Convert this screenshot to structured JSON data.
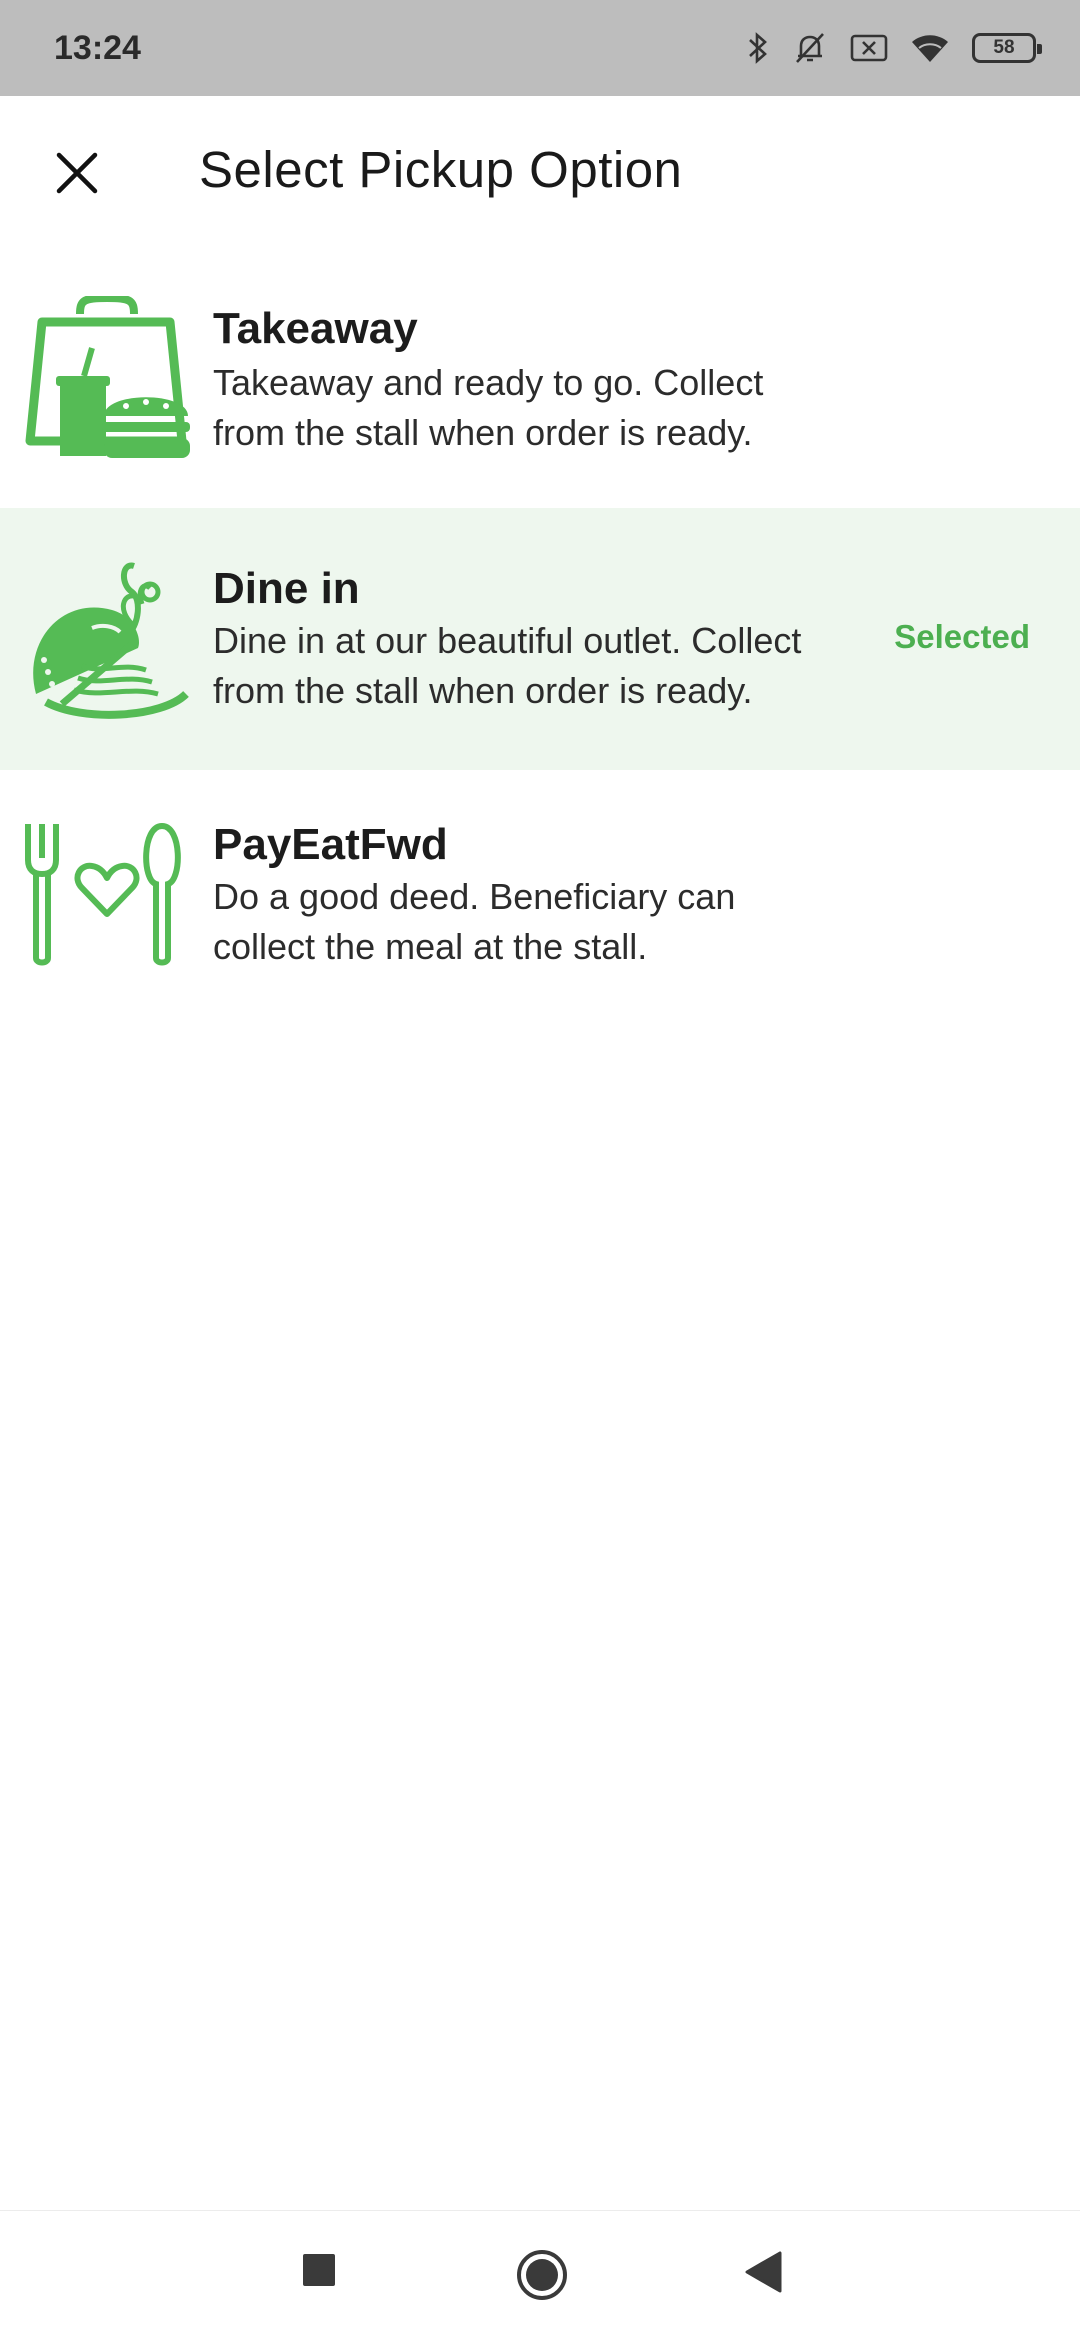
{
  "status_bar": {
    "time": "13:24",
    "battery": "58",
    "icons": [
      "bluetooth-icon",
      "bell-off-icon",
      "sim-off-icon",
      "wifi-icon",
      "battery-icon"
    ]
  },
  "header": {
    "title": "Select Pickup Option",
    "close_icon": "close-icon"
  },
  "options": [
    {
      "title": "Takeaway",
      "description_line1": "Takeaway and ready to go. Collect",
      "description_line2": "from the stall when order is ready.",
      "icon": "takeaway-bag-icon",
      "selected": false
    },
    {
      "title": "Dine in",
      "description_line1": "Dine in at our beautiful outlet. Collect",
      "description_line2": "from the stall when order is ready.",
      "icon": "cloche-dish-icon",
      "selected": true,
      "selected_label": "Selected"
    },
    {
      "title": "PayEatFwd",
      "description_line1": "Do a good deed. Beneficiary can",
      "description_line2": "collect the meal at the stall.",
      "icon": "fork-heart-spoon-icon",
      "selected": false
    }
  ],
  "colors": {
    "accent_green": "#4caf50",
    "selected_row_bg": "#eef7ee",
    "status_bar_bg": "#bdbdbd"
  },
  "nav_bar": {
    "icons": [
      "recents-square-icon",
      "home-circle-icon",
      "back-triangle-icon"
    ]
  }
}
